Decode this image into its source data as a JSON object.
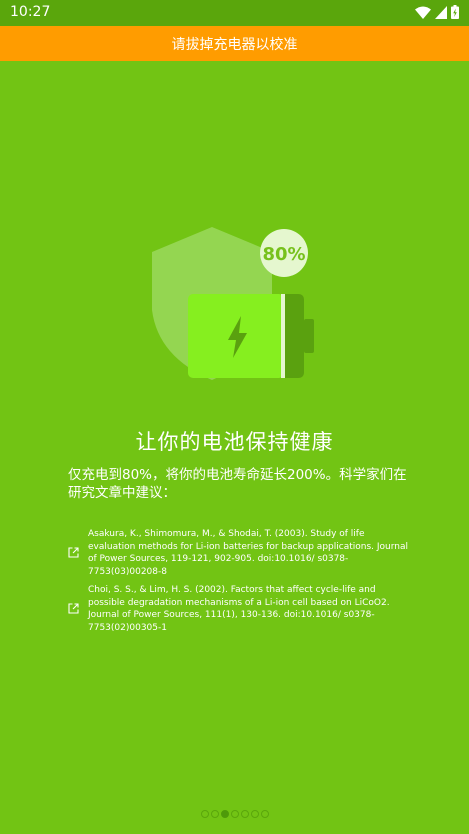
{
  "status_bar": {
    "time": "10:27",
    "icons": [
      "wifi-icon",
      "signal-icon",
      "battery-charging-icon"
    ]
  },
  "banner": {
    "text": "请拔掉充电器以校准"
  },
  "illustration": {
    "percent_label": "80%",
    "icons": [
      "shield-icon",
      "battery-icon",
      "lightning-icon"
    ]
  },
  "content": {
    "title": "让你的电池保持健康",
    "description": "仅充电到80%，将你的电池寿命延长200%。科学家们在研究文章中建议："
  },
  "references": [
    {
      "text": "Asakura, K., Shimomura, M., & Shodai, T. (2003). Study of life evaluation methods for Li-ion batteries for backup applications. Journal of Power Sources, 119-121, 902-905. doi:10.1016/ s0378-7753(03)00208-8"
    },
    {
      "text": "Choi, S. S., & Lim, H. S. (2002). Factors that affect cycle-life and possible degradation mechanisms of a Li-ion cell based on LiCoO2. Journal of Power Sources, 111(1), 130-136. doi:10.1016/ s0378-7753(02)00305-1"
    }
  ],
  "pager": {
    "count": 7,
    "active_index": 2
  },
  "colors": {
    "background": "#72c414",
    "status_bar": "#5aa60c",
    "banner": "#ff9c00",
    "battery": "#86ef1f",
    "shield": "#94d651"
  }
}
